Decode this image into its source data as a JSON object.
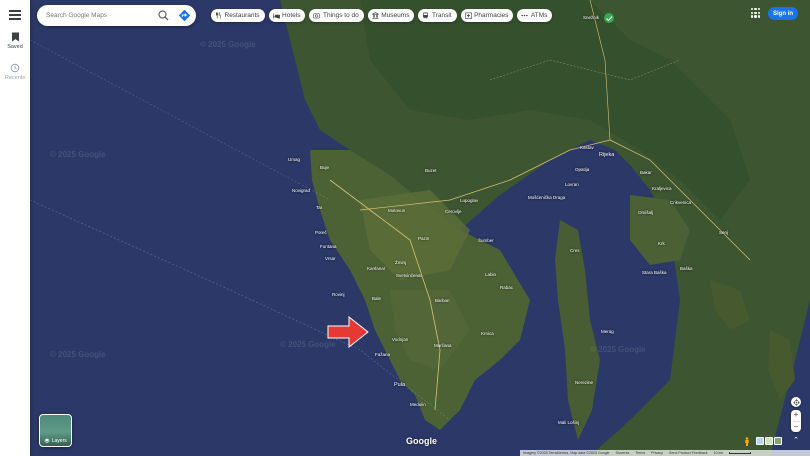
{
  "rail": {
    "saved_label": "Saved",
    "recents_label": "Recents"
  },
  "search": {
    "placeholder": "Search Google Maps"
  },
  "chips": [
    {
      "label": "Restaurants",
      "icon": "restaurant-icon"
    },
    {
      "label": "Hotels",
      "icon": "hotel-icon"
    },
    {
      "label": "Things to do",
      "icon": "camera-icon"
    },
    {
      "label": "Museums",
      "icon": "museum-icon"
    },
    {
      "label": "Transit",
      "icon": "transit-icon"
    },
    {
      "label": "Pharmacies",
      "icon": "pharmacy-icon"
    },
    {
      "label": "ATMs",
      "icon": "more-icon"
    }
  ],
  "header": {
    "signin_label": "Sign in"
  },
  "layers": {
    "label": "Layers"
  },
  "map": {
    "logo": "Google",
    "watermark": "© 2025 Google",
    "places": {
      "snezhnik": "Snežnik",
      "rijeka": "Rijeka",
      "opatija": "Opatija",
      "novigrad": "Novigrad",
      "buzet": "Buzet",
      "motovun": "Motovun",
      "porec": "Poreč",
      "pazin": "Pazin",
      "labin": "Labin",
      "rabac": "Rabac",
      "rovinj": "Rovinj",
      "vodnjan": "Vodnjan",
      "pula": "Pula",
      "medulin": "Medulin",
      "fazana": "Fažana",
      "bale": "Bale",
      "cres": "Cres",
      "krk": "Krk",
      "mali_losinj": "Mali Lošinj",
      "omisalj": "Omišalj",
      "crikvenica": "Crikvenica",
      "senj": "Senj",
      "baska": "Baška",
      "merag": "Merag",
      "nerezine": "Nerezine",
      "umag": "Umag",
      "tar": "Tar",
      "buje": "Buje",
      "vrsar": "Vrsar",
      "funtana": "Funtana",
      "kanfanar": "Kanfanar",
      "zminj": "Žminj",
      "sumber": "Šumber",
      "barban": "Barban",
      "svetvincenat": "Svetvinčenat",
      "krnica": "Krnica",
      "marcana": "Marčana",
      "cerovlje": "Cerovlje",
      "lupoglav": "Lupoglav",
      "mosc_draga": "Mošćenička Draga",
      "lovran": "Lovran",
      "kastav": "Kastav",
      "bakar": "Bakar",
      "kraljevica": "Kraljevica",
      "stara_baska": "Stara Baška"
    }
  },
  "footer": {
    "imagery": "Imagery ©2025 TerraMetrics, Map data ©2025 Google",
    "country": "Slovenia",
    "terms": "Terms",
    "privacy": "Privacy",
    "feedback": "Send Product Feedback",
    "scale": "10 km"
  },
  "colors": {
    "accent": "#1a73e8",
    "arrow": "#e53935"
  }
}
